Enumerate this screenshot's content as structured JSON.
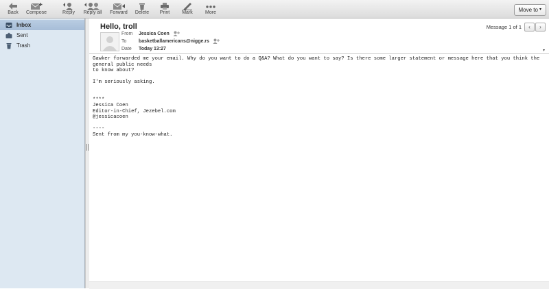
{
  "toolbar": {
    "back": "Back",
    "compose": "Compose",
    "reply": "Reply",
    "reply_all": "Reply all",
    "forward": "Forward",
    "delete": "Delete",
    "print": "Print",
    "mark": "Mark",
    "more": "More",
    "move_to": "Move to"
  },
  "sidebar": {
    "items": [
      {
        "label": "Inbox",
        "icon": "inbox-icon"
      },
      {
        "label": "Sent",
        "icon": "sent-icon"
      },
      {
        "label": "Trash",
        "icon": "trash-icon"
      }
    ]
  },
  "message": {
    "subject": "Hello, troll",
    "counter": "Message 1 of 1",
    "from_label": "From",
    "from": "Jessica Coen",
    "to_label": "To",
    "to": "basketballamericans@nigge.rs",
    "date_label": "Date",
    "date": "Today 13:27",
    "body": "Gawker forwarded me your email. Why do you want to do a Q&A? What do you want to say? Is there some larger statement or message here that you think the general public needs\nto know about?\n\nI'm seriously asking.\n\n\n****\nJessica Coen\nEditor-in-Chief, Jezebel.com\n@jessicacoen\n\n----\nSent from my you-know-what."
  },
  "colors": {
    "sidebar_bg": "#dde8f2",
    "selected": "#a7bed8",
    "toolbar_bg": "#dcdcdc"
  }
}
